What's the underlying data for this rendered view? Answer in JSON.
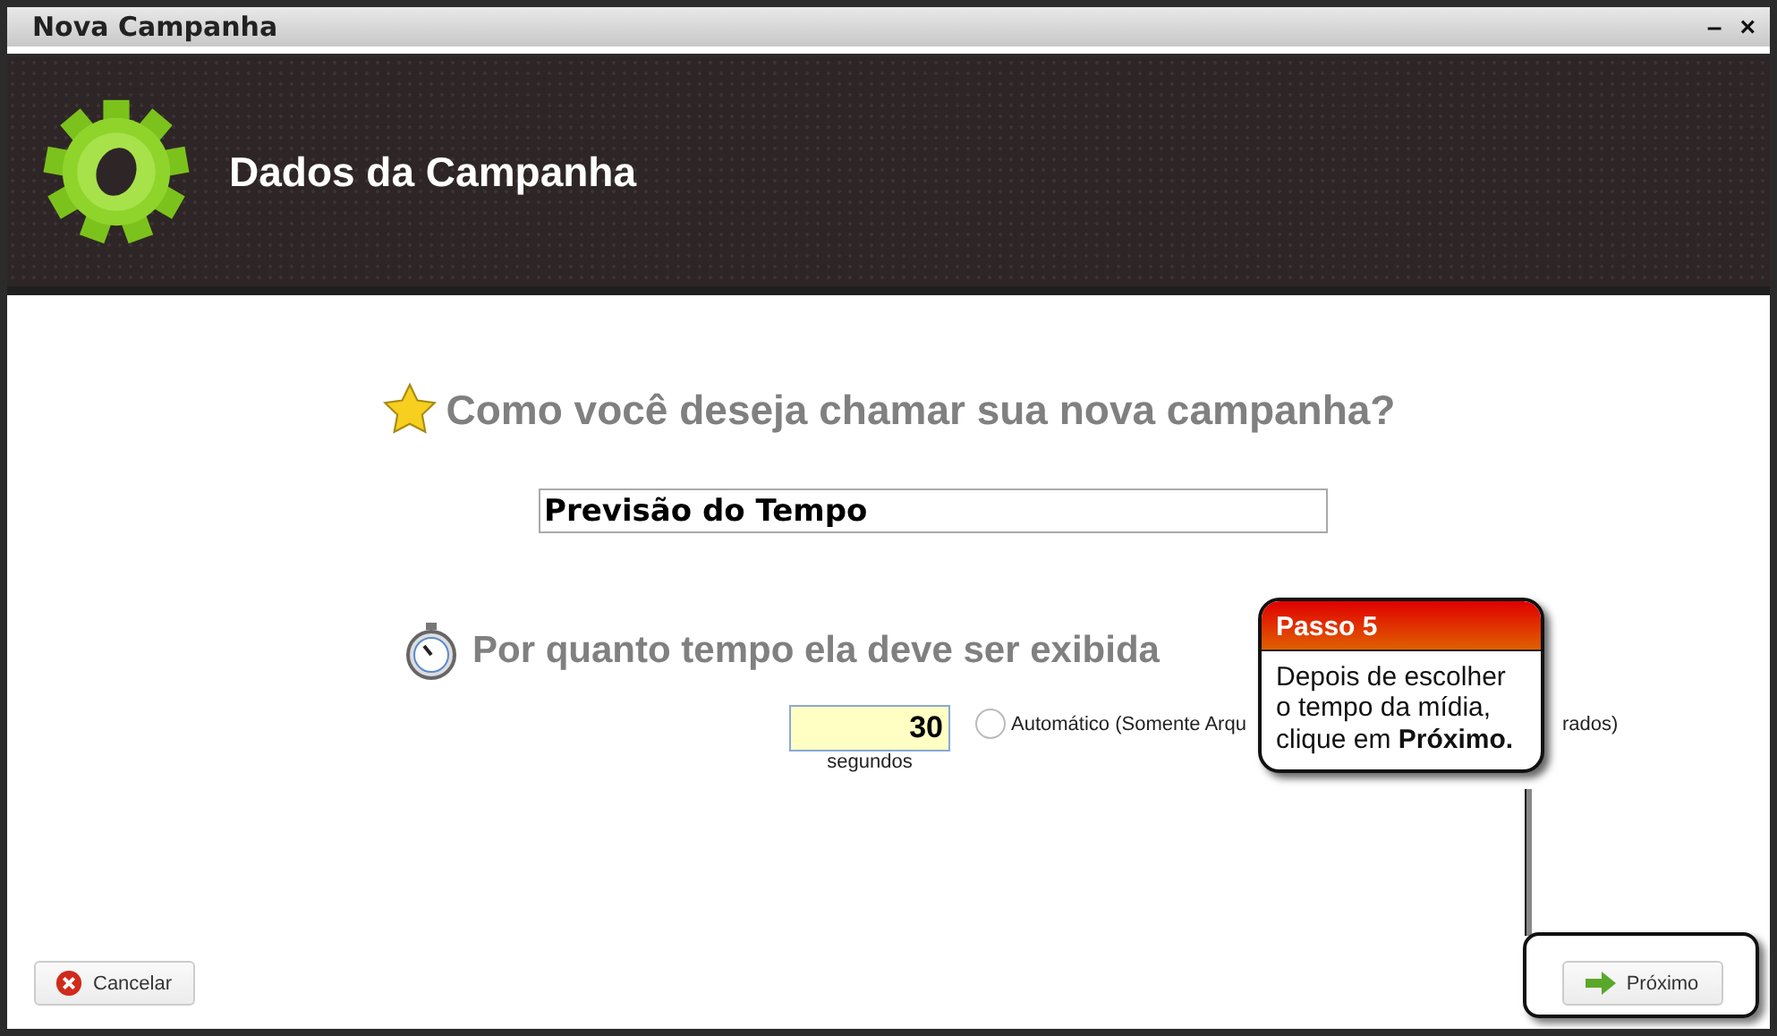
{
  "window": {
    "title": "Nova Campanha",
    "controls": [
      "–",
      "×"
    ]
  },
  "header": {
    "title": "Dados da Campanha"
  },
  "name_question": {
    "text": "Como você deseja chamar sua nova campanha?",
    "value": "Previsão do Tempo"
  },
  "time_question": {
    "text": "Por quanto tempo ela deve ser exibida",
    "value": "30",
    "unit": "segundos",
    "auto_option": {
      "label_start": "Automático (Somente Arqu",
      "label_end": "rados)",
      "checked": false
    }
  },
  "callout": {
    "title": "Passo 5",
    "text": "Depois de escolher o tempo da mídia, clique em **Próximo.**"
  },
  "buttons": [
    {
      "kind": "cancel",
      "label": "Cancelar"
    },
    {
      "kind": "next",
      "label": "Próximo",
      "highlighted": true
    }
  ]
}
